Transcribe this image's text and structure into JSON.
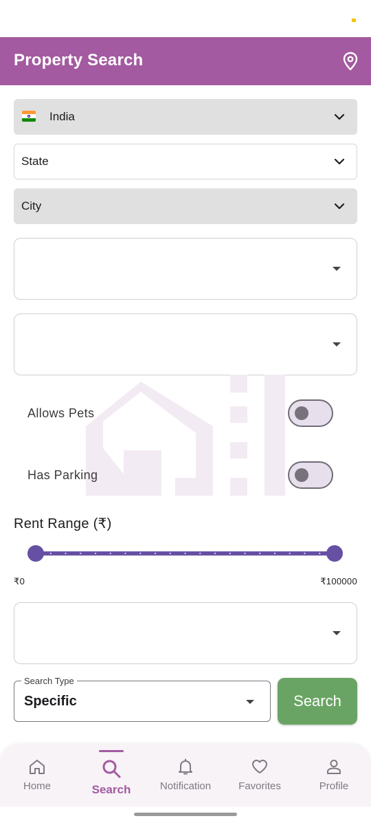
{
  "app_bar": {
    "title": "Property Search",
    "accent_color": "#a35aa0",
    "action_icon": "location-pin-icon"
  },
  "filters": {
    "country": {
      "value": "India",
      "flag": "india-flag-icon"
    },
    "state": {
      "placeholder": "State"
    },
    "city": {
      "placeholder": "City"
    }
  },
  "toggles": [
    {
      "label": "Allows Pets",
      "on": false
    },
    {
      "label": "Has Parking",
      "on": false
    }
  ],
  "rent": {
    "title": "Rent Range (₹)",
    "min_label": "₹0",
    "max_label": "₹100000",
    "range_low": 0,
    "range_high": 100000,
    "accent_color": "#6550a4"
  },
  "search_type": {
    "legend": "Search Type",
    "value": "Specific"
  },
  "search_button": {
    "label": "Search",
    "color": "#6aa464"
  },
  "bottom_nav": {
    "items": [
      {
        "label": "Home",
        "icon": "home-icon",
        "active": false
      },
      {
        "label": "Search",
        "icon": "search-icon",
        "active": true
      },
      {
        "label": "Notification",
        "icon": "bell-icon",
        "active": false
      },
      {
        "label": "Favorites",
        "icon": "heart-icon",
        "active": false
      },
      {
        "label": "Profile",
        "icon": "person-icon",
        "active": false
      }
    ]
  }
}
